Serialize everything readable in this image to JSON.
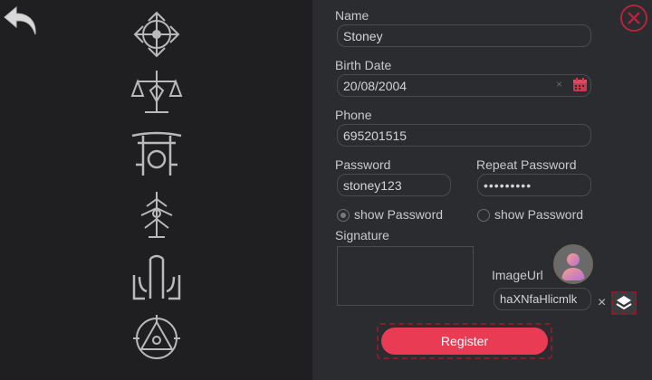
{
  "form": {
    "name_label": "Name",
    "name_value": "Stoney",
    "birth_label": "Birth Date",
    "birth_value": "20/08/2004",
    "phone_label": "Phone",
    "phone_value": "695201515",
    "password_label": "Password",
    "password_value": "stoney123",
    "repeat_label": "Repeat Password",
    "repeat_value": "•••••••••",
    "show_password_1": "show Password",
    "show_password_2": "show Password",
    "signature_label": "Signature",
    "image_url_label": "ImageUrl",
    "image_url_value": "haXNfaHlicmlk",
    "register_label": "Register",
    "clear_symbol": "×"
  },
  "icons": {
    "back": "back-arrow-icon",
    "close": "close-circle-icon",
    "calendar": "calendar-icon",
    "layers": "layers-icon"
  },
  "colors": {
    "accent": "#ea3b55",
    "panel": "#2b2c2f",
    "background": "#1f1f21"
  }
}
